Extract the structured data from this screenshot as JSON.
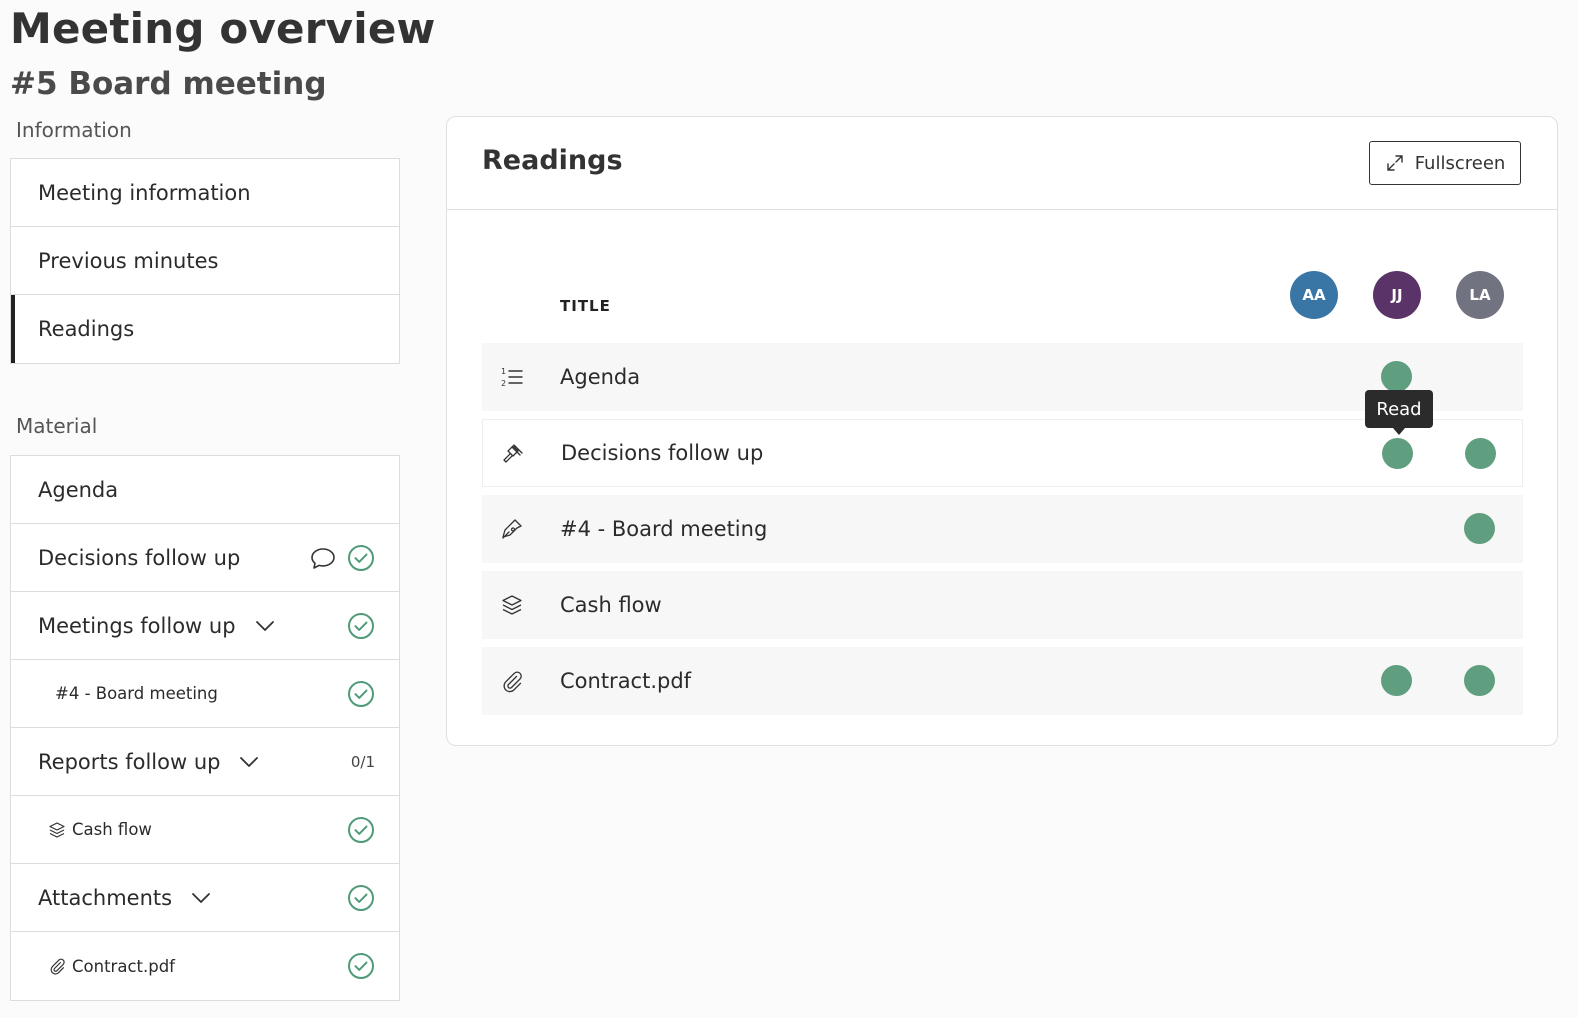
{
  "page": {
    "title": "Meeting overview",
    "subtitle": "#5 Board meeting"
  },
  "sidebar": {
    "information_label": "Information",
    "information_items": [
      {
        "label": "Meeting information"
      },
      {
        "label": "Previous minutes"
      },
      {
        "label": "Readings",
        "active": true
      }
    ],
    "material_label": "Material",
    "material_items": [
      {
        "label": "Agenda"
      },
      {
        "label": "Decisions follow up",
        "icons": [
          "comment-icon",
          "check-circle-icon"
        ]
      },
      {
        "label": "Meetings follow up",
        "icons": [
          "chevron-down-icon",
          "check-circle-icon"
        ]
      },
      {
        "label": "#4 - Board meeting",
        "icons": [
          "check-circle-icon"
        ]
      },
      {
        "label": "Reports follow up",
        "count": "0/1",
        "icons": [
          "chevron-down-icon"
        ]
      },
      {
        "label": "Cash flow",
        "icons": [
          "layers-icon",
          "check-circle-icon"
        ]
      },
      {
        "label": "Attachments",
        "icons": [
          "chevron-down-icon",
          "check-circle-icon"
        ]
      },
      {
        "label": "Contract.pdf",
        "icons": [
          "paperclip-icon",
          "check-circle-icon"
        ]
      }
    ]
  },
  "readings": {
    "title": "Readings",
    "fullscreen_label": "Fullscreen",
    "column_title": "TITLE",
    "avatars": [
      {
        "initials": "AA",
        "color": "#3a76a5"
      },
      {
        "initials": "JJ",
        "color": "#5a3468"
      },
      {
        "initials": "LA",
        "color": "#727380"
      }
    ],
    "rows": [
      {
        "label": "Agenda",
        "icon": "numbered-list-icon",
        "read_by": [
          "JJ"
        ]
      },
      {
        "label": "Decisions follow up",
        "icon": "gavel-icon",
        "read_by": [
          "JJ",
          "LA"
        ]
      },
      {
        "label": "#4 - Board meeting",
        "icon": "pen-icon",
        "read_by": [
          "LA"
        ]
      },
      {
        "label": "Cash flow",
        "icon": "layers-icon",
        "read_by": []
      },
      {
        "label": "Contract.pdf",
        "icon": "paperclip-icon",
        "read_by": [
          "JJ",
          "LA"
        ]
      }
    ],
    "tooltip": "Read",
    "read_color": "#5f9e7e",
    "check_color": "#4f9a77"
  }
}
